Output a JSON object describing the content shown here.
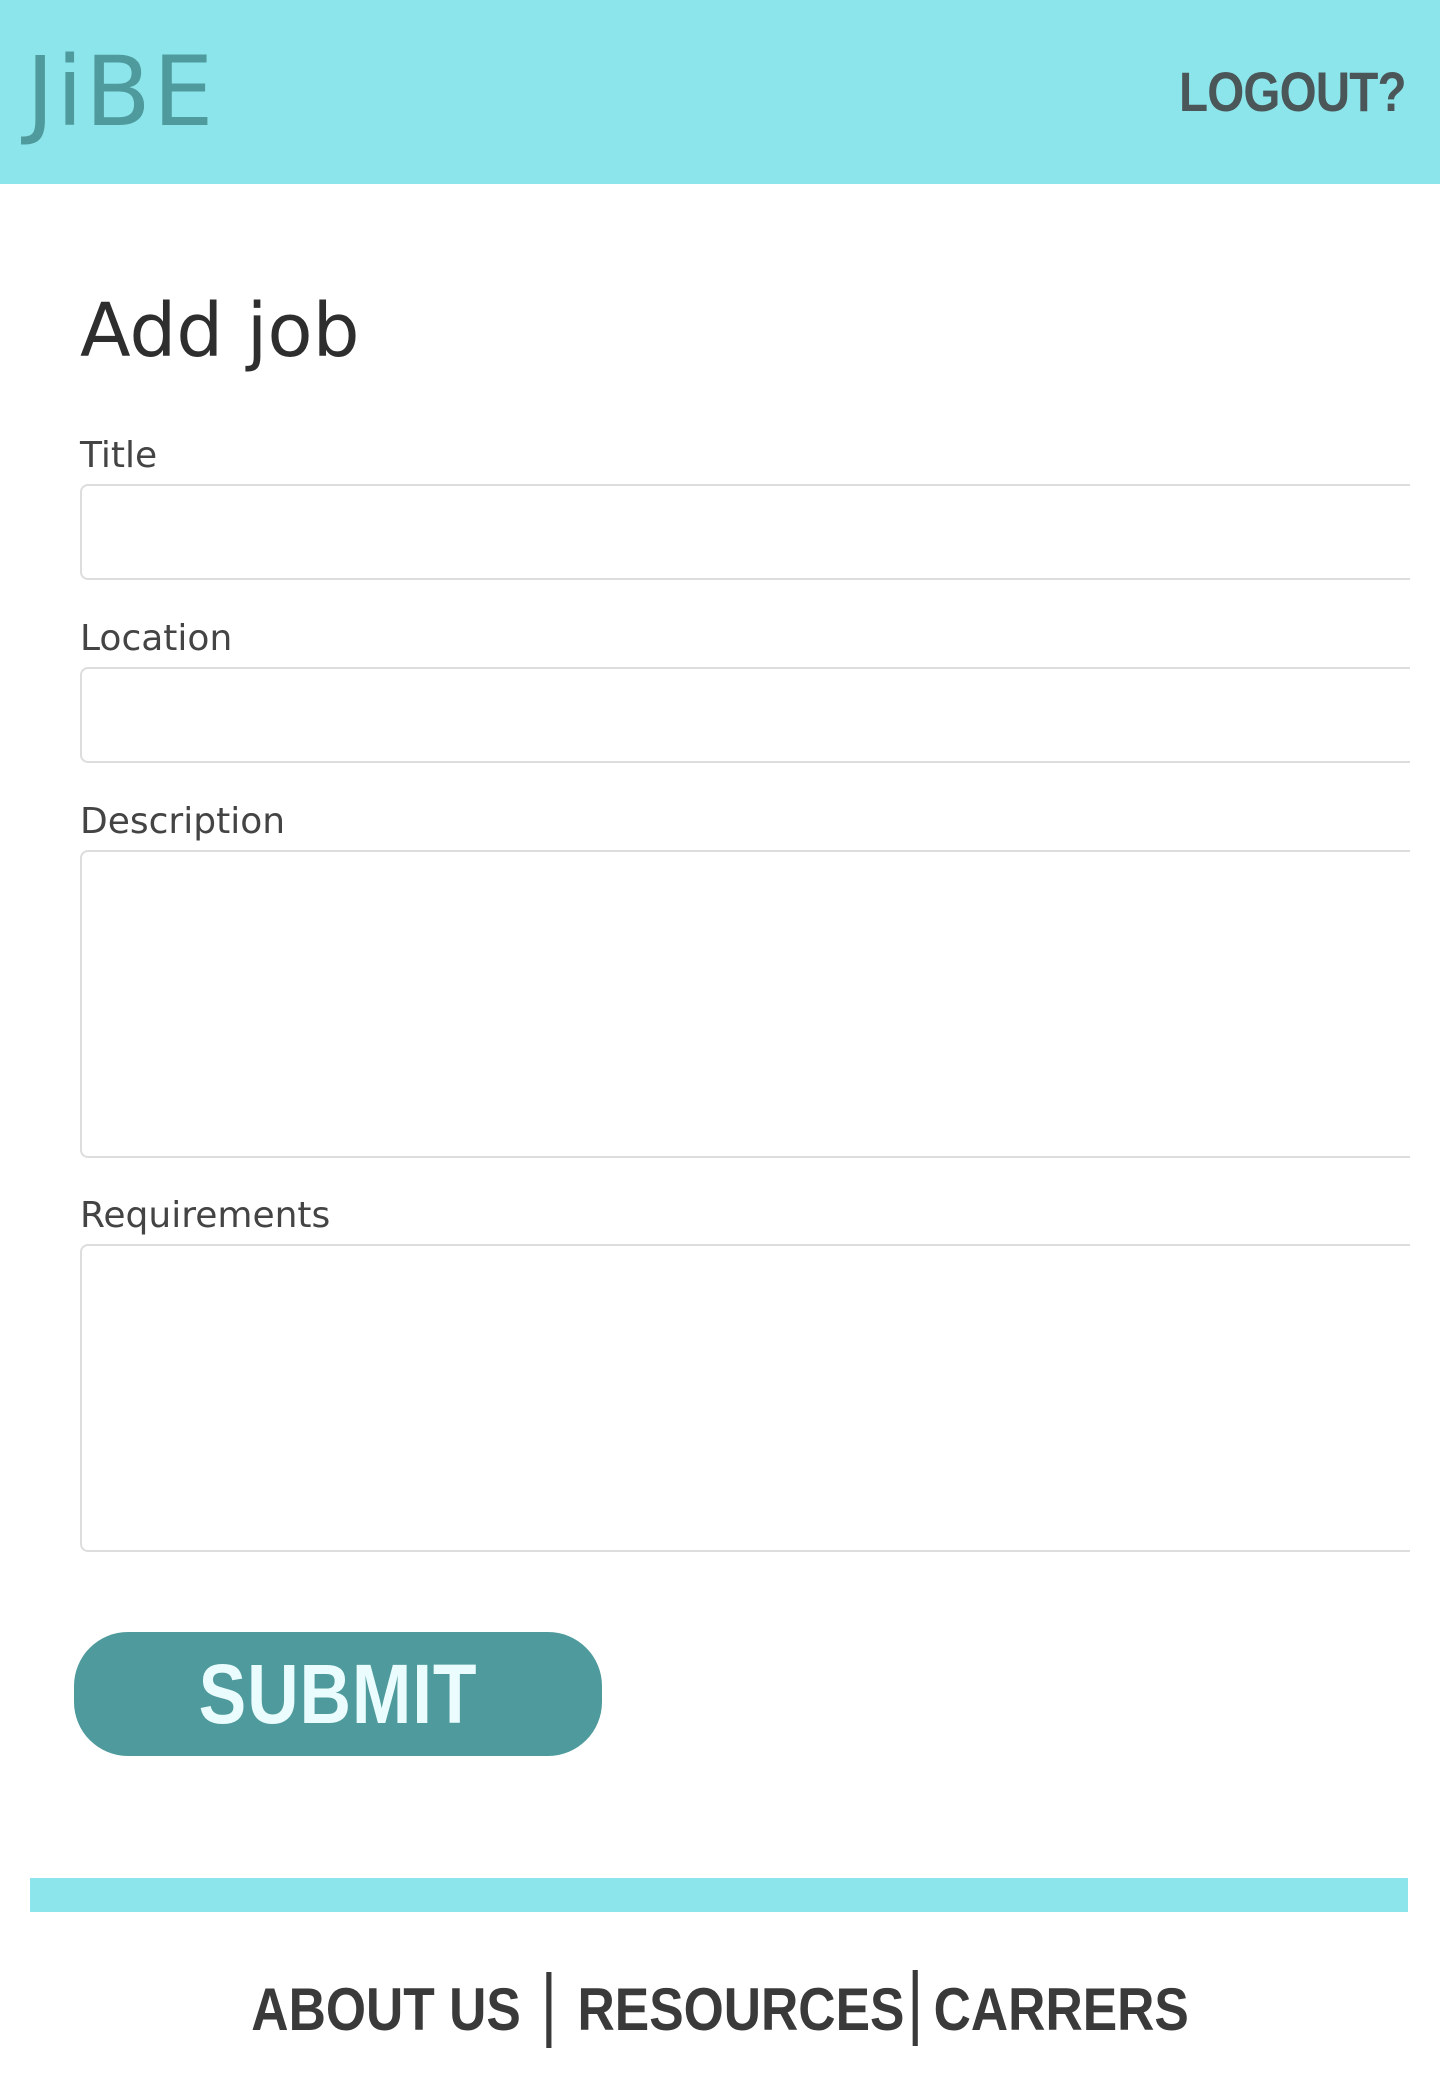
{
  "header": {
    "logo": "JiBE",
    "logout_label": "LOGOUT?"
  },
  "main": {
    "title": "Add job",
    "fields": {
      "title": {
        "label": "Title",
        "value": ""
      },
      "location": {
        "label": "Location",
        "value": ""
      },
      "description": {
        "label": "Description",
        "value": ""
      },
      "requirements": {
        "label": "Requirements",
        "value": ""
      }
    },
    "submit_label": "SUBMIT"
  },
  "footer": {
    "links": [
      "ABOUT US",
      "RESOURCES",
      "CARRERS"
    ]
  },
  "colors": {
    "header_bg": "#8ce5ea",
    "brand": "#4e9a9c",
    "text": "#333333"
  }
}
